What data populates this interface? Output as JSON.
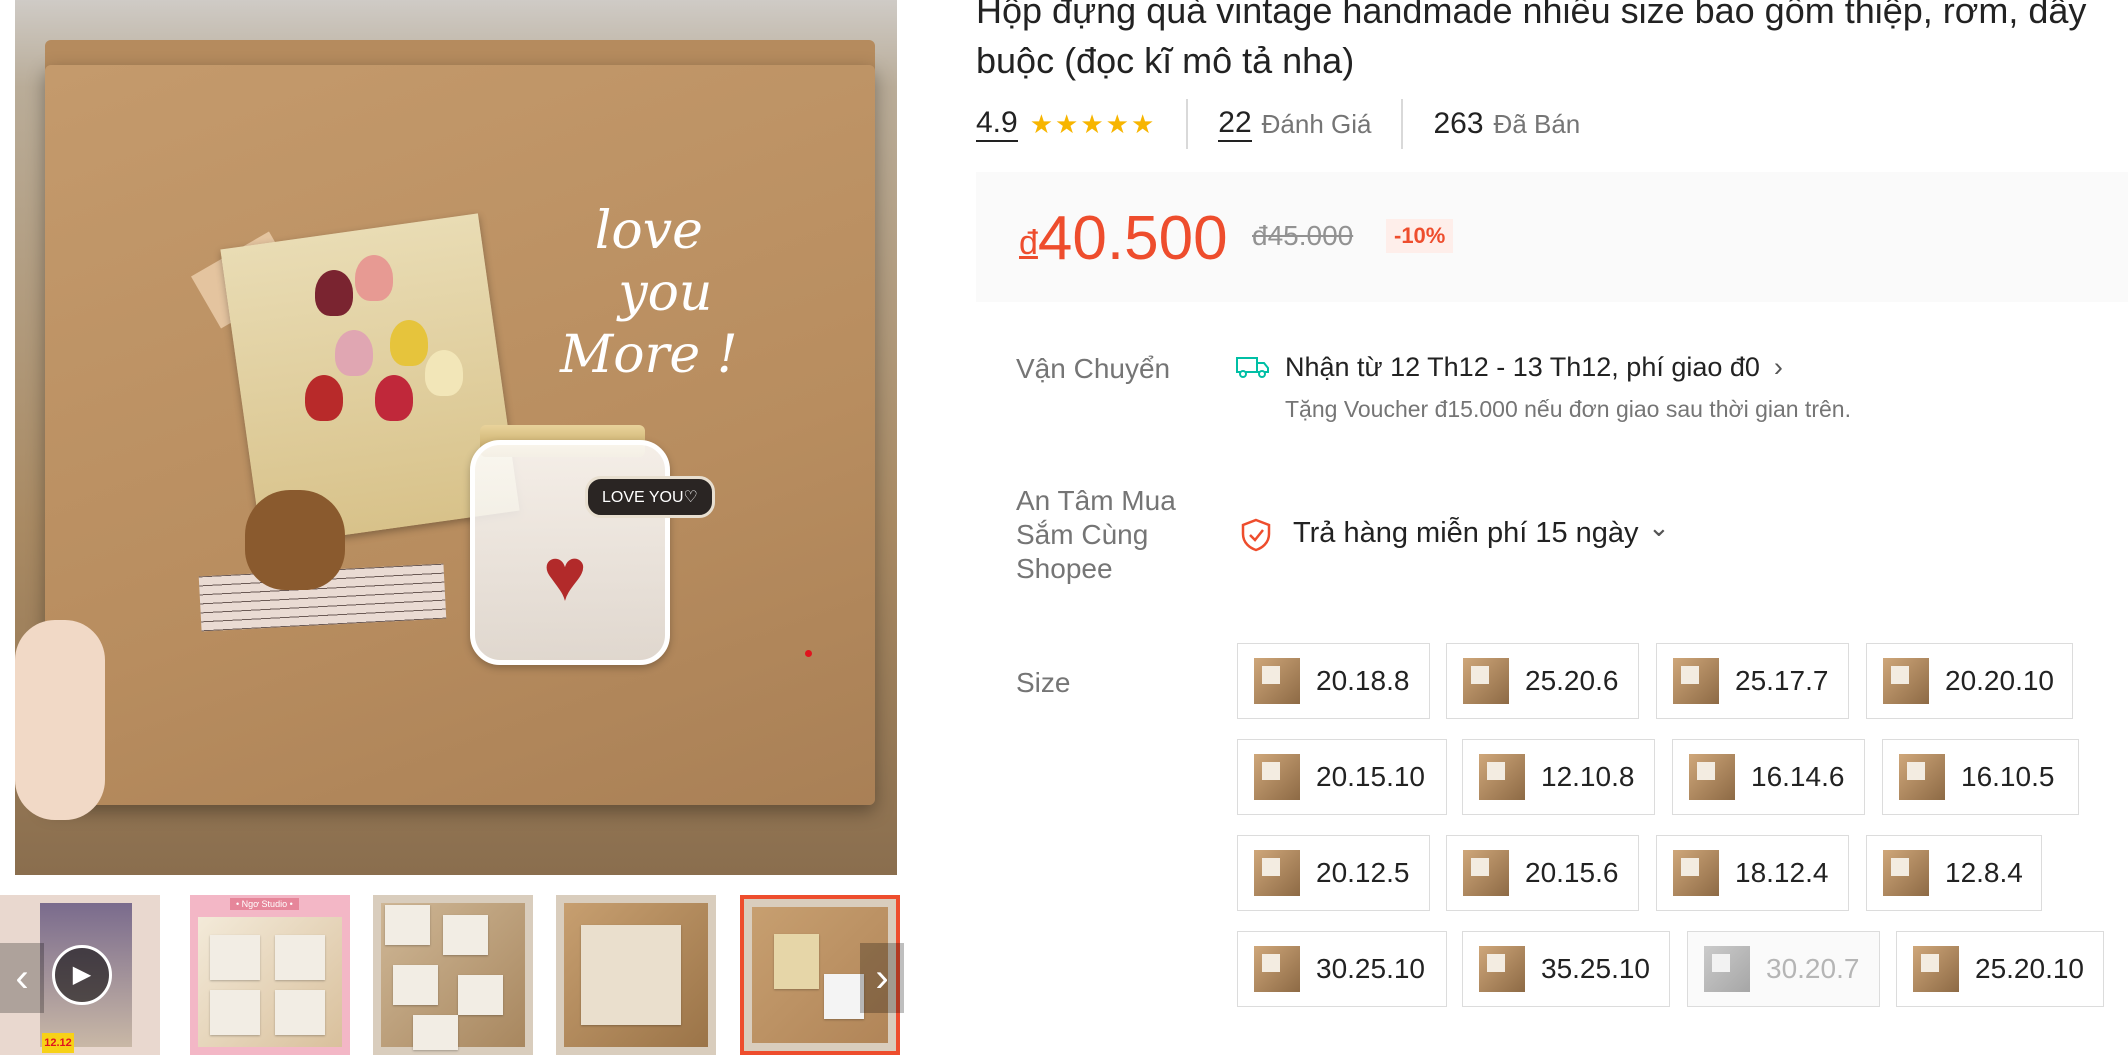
{
  "product": {
    "title": "Hộp đựng quà vintage handmade nhiều size bao gồm thiệp, rơm, dây buộc (đọc kĩ mô tả nha)",
    "rating": "4.9",
    "stars": "★★★★★",
    "reviews_count": "22",
    "reviews_label": "Đánh Giá",
    "sold_count": "263",
    "sold_label": "Đã Bán"
  },
  "price": {
    "currency": "đ",
    "current": "40.500",
    "original": "đ45.000",
    "discount": "-10%"
  },
  "image": {
    "overlay_script": "love\n  you\nMore !",
    "jar_tag": "LOVE YOU♡",
    "heart": "♥"
  },
  "thumbnails": {
    "badge": "12.12",
    "label": "• Ngơ Studio •",
    "prev_arrow": "‹",
    "next_arrow": "›",
    "play_icon": "▶"
  },
  "shipping": {
    "label": "Vận Chuyển",
    "main": "Nhận từ 12 Th12 - 13 Th12, phí giao đ0",
    "chevron": "›",
    "voucher": "Tặng Voucher đ15.000 nếu đơn giao sau thời gian trên."
  },
  "guarantee": {
    "label": "An Tâm Mua\nSắm Cùng\nShopee",
    "text": "Trả hàng miễn phí 15 ngày",
    "chevron": "⌄"
  },
  "size": {
    "label": "Size",
    "options": [
      {
        "label": "20.18.8"
      },
      {
        "label": "25.20.6"
      },
      {
        "label": "25.17.7"
      },
      {
        "label": "20.20.10"
      },
      {
        "label": "20.15.10"
      },
      {
        "label": "12.10.8"
      },
      {
        "label": "16.14.6"
      },
      {
        "label": "16.10.5"
      },
      {
        "label": "20.12.5"
      },
      {
        "label": "20.15.6"
      },
      {
        "label": "18.12.4"
      },
      {
        "label": "12.8.4"
      },
      {
        "label": "30.25.10"
      },
      {
        "label": "35.25.10"
      },
      {
        "label": "30.20.7",
        "disabled": true
      },
      {
        "label": "25.20.10"
      }
    ]
  },
  "colors": {
    "accent": "#ee4d2d",
    "star": "#f7b500",
    "shipping_icon": "#00bfa5"
  }
}
